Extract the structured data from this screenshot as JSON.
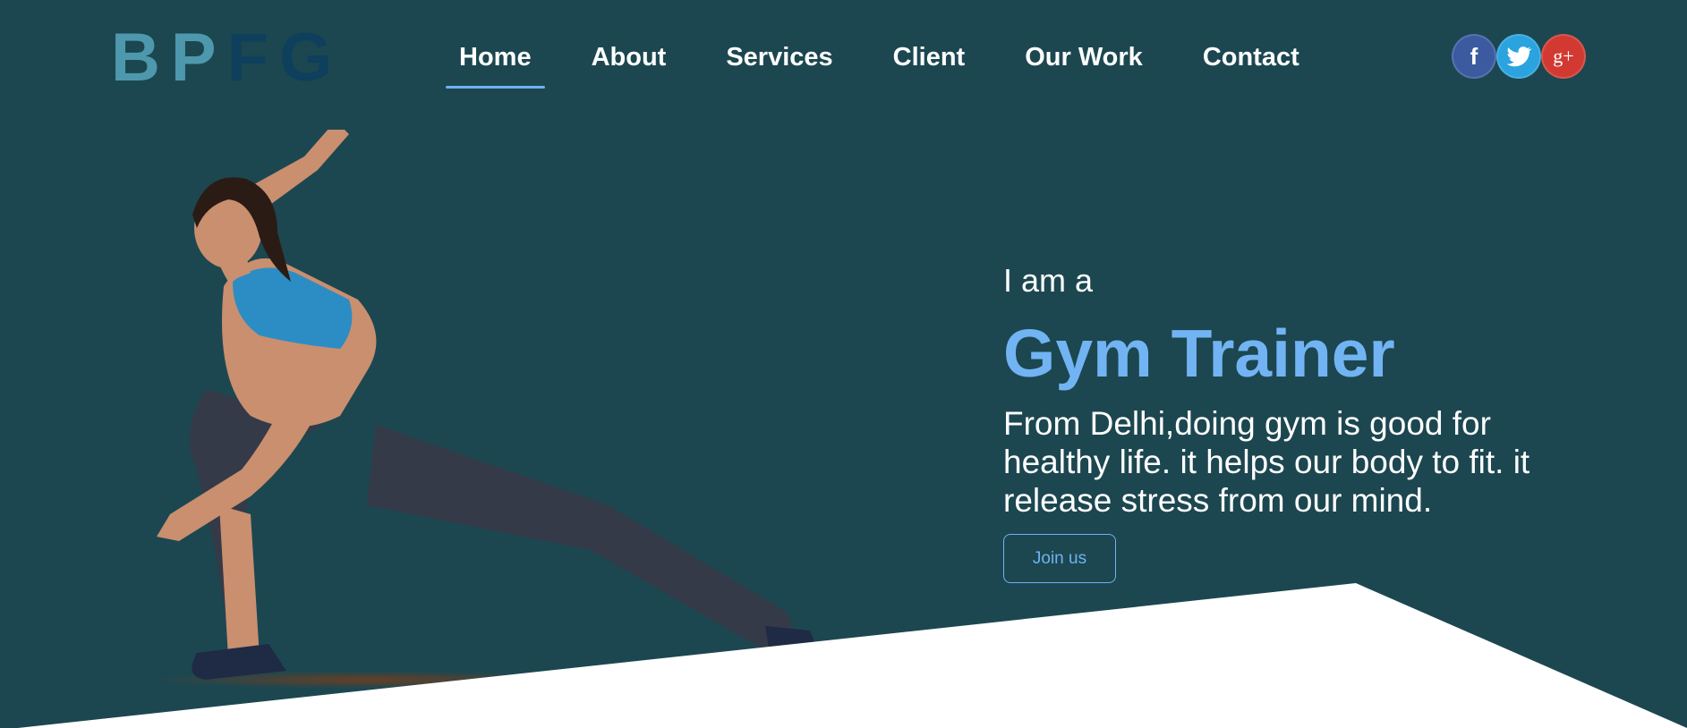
{
  "logo": {
    "part1": "BP",
    "part2": "FG"
  },
  "nav": {
    "items": [
      {
        "label": "Home",
        "active": true
      },
      {
        "label": "About",
        "active": false
      },
      {
        "label": "Services",
        "active": false
      },
      {
        "label": "Client",
        "active": false
      },
      {
        "label": "Our Work",
        "active": false
      },
      {
        "label": "Contact",
        "active": false
      }
    ]
  },
  "social": {
    "facebook": {
      "icon": "facebook-icon",
      "glyph": "f",
      "color": "#3b5aa0"
    },
    "twitter": {
      "icon": "twitter-icon",
      "color": "#2aa3df"
    },
    "googleplus": {
      "icon": "google-plus-icon",
      "glyph": "g+",
      "color": "#d23a31"
    }
  },
  "hero": {
    "intro": "I am a",
    "role": "Gym Trainer",
    "description": "From Delhi,doing gym is good for healthy life. it helps our body to fit. it release stress from our mind.",
    "button_label": "Join us"
  },
  "colors": {
    "background": "#1c4750",
    "accent": "#72b4f3",
    "logo_light": "#4e98ad",
    "logo_dark": "#0e3f5c"
  }
}
